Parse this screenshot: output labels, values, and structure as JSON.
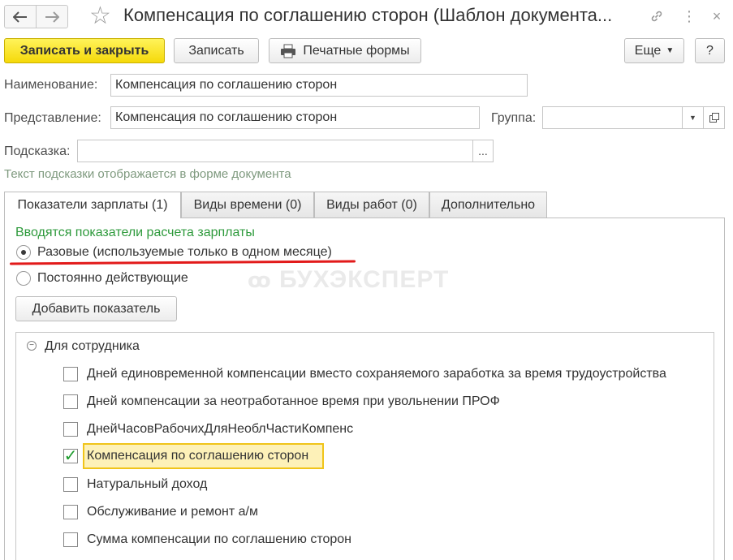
{
  "window": {
    "title": "Компенсация по соглашению сторон (Шаблон документа..."
  },
  "toolbar": {
    "save_close": "Записать и закрыть",
    "save": "Записать",
    "print_forms": "Печатные формы",
    "more": "Еще",
    "help": "?"
  },
  "fields": {
    "name_label": "Наименование:",
    "name_value": "Компенсация по соглашению сторон",
    "repr_label": "Представление:",
    "repr_value": "Компенсация по соглашению сторон",
    "group_label": "Группа:",
    "group_value": "",
    "hint_label": "Подсказка:",
    "hint_value": "",
    "hint_btn": "...",
    "hint_note": "Текст подсказки отображается в форме документа"
  },
  "tabs": [
    {
      "label": "Показатели зарплаты (1)"
    },
    {
      "label": "Виды времени (0)"
    },
    {
      "label": "Виды работ (0)"
    },
    {
      "label": "Дополнительно"
    }
  ],
  "panel": {
    "caption": "Вводятся показатели расчета зарплаты",
    "radio_one_time": "Разовые (используемые только в одном месяце)",
    "radio_permanent": "Постоянно действующие",
    "add_button": "Добавить показатель",
    "watermark": "БУХЭКСПЕРТ"
  },
  "tree": {
    "group": "Для сотрудника",
    "items": [
      {
        "label": "Дней единовременной компенсации вместо сохраняемого заработка за время трудоустройства",
        "checked": false
      },
      {
        "label": "Дней компенсации за неотработанное время при увольнении ПРОФ",
        "checked": false
      },
      {
        "label": "ДнейЧасовРабочихДляНеоблЧастиКомпенс",
        "checked": false
      },
      {
        "label": "Компенсация по соглашению сторон",
        "checked": true
      },
      {
        "label": "Натуральный доход",
        "checked": false
      },
      {
        "label": "Обслуживание и ремонт а/м",
        "checked": false
      },
      {
        "label": "Сумма компенсации по соглашению сторон",
        "checked": false
      }
    ]
  },
  "colors": {
    "primary_button": "#f5d90a",
    "accent_green": "#2e9a3c",
    "annotation_red": "#e21a1a",
    "highlight_border": "#f0c419"
  }
}
